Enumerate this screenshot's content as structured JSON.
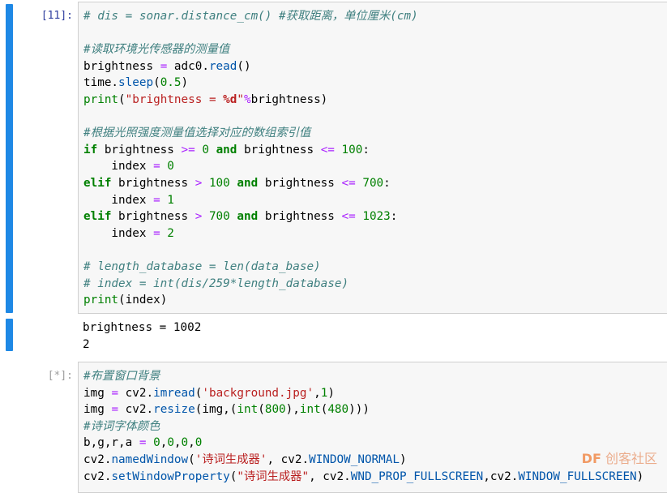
{
  "cells": [
    {
      "prompt": "[11]:",
      "lines": [
        [
          {
            "t": "# dis = sonar.distance_cm() #获取距离，单位厘米(cm)",
            "c": "cm"
          }
        ],
        [],
        [
          {
            "t": "#读取环境光传感器的测量值",
            "c": "cm"
          }
        ],
        [
          {
            "t": "brightness "
          },
          {
            "t": "=",
            "c": "op"
          },
          {
            "t": " adc0."
          },
          {
            "t": "read",
            "c": "fn"
          },
          {
            "t": "()"
          }
        ],
        [
          {
            "t": "time."
          },
          {
            "t": "sleep",
            "c": "fn"
          },
          {
            "t": "("
          },
          {
            "t": "0.5",
            "c": "num"
          },
          {
            "t": ")"
          }
        ],
        [
          {
            "t": "print",
            "c": "num"
          },
          {
            "t": "("
          },
          {
            "t": "\"brightness = ",
            "c": "str"
          },
          {
            "t": "%d",
            "c": "sp"
          },
          {
            "t": "\"",
            "c": "str"
          },
          {
            "t": "%",
            "c": "op"
          },
          {
            "t": "brightness)"
          }
        ],
        [],
        [
          {
            "t": "#根据光照强度测量值选择对应的数组索引值",
            "c": "cm"
          }
        ],
        [
          {
            "t": "if",
            "c": "kw"
          },
          {
            "t": " brightness "
          },
          {
            "t": ">=",
            "c": "op"
          },
          {
            "t": " "
          },
          {
            "t": "0",
            "c": "num"
          },
          {
            "t": " "
          },
          {
            "t": "and",
            "c": "kw"
          },
          {
            "t": " brightness "
          },
          {
            "t": "<=",
            "c": "op"
          },
          {
            "t": " "
          },
          {
            "t": "100",
            "c": "num"
          },
          {
            "t": ":"
          }
        ],
        [
          {
            "t": "    index "
          },
          {
            "t": "=",
            "c": "op"
          },
          {
            "t": " "
          },
          {
            "t": "0",
            "c": "num"
          }
        ],
        [
          {
            "t": "elif",
            "c": "kw"
          },
          {
            "t": " brightness "
          },
          {
            "t": ">",
            "c": "op"
          },
          {
            "t": " "
          },
          {
            "t": "100",
            "c": "num"
          },
          {
            "t": " "
          },
          {
            "t": "and",
            "c": "kw"
          },
          {
            "t": " brightness "
          },
          {
            "t": "<=",
            "c": "op"
          },
          {
            "t": " "
          },
          {
            "t": "700",
            "c": "num"
          },
          {
            "t": ":"
          }
        ],
        [
          {
            "t": "    index "
          },
          {
            "t": "=",
            "c": "op"
          },
          {
            "t": " "
          },
          {
            "t": "1",
            "c": "num"
          }
        ],
        [
          {
            "t": "elif",
            "c": "kw"
          },
          {
            "t": " brightness "
          },
          {
            "t": ">",
            "c": "op"
          },
          {
            "t": " "
          },
          {
            "t": "700",
            "c": "num"
          },
          {
            "t": " "
          },
          {
            "t": "and",
            "c": "kw"
          },
          {
            "t": " brightness "
          },
          {
            "t": "<=",
            "c": "op"
          },
          {
            "t": " "
          },
          {
            "t": "1023",
            "c": "num"
          },
          {
            "t": ":"
          }
        ],
        [
          {
            "t": "    index "
          },
          {
            "t": "=",
            "c": "op"
          },
          {
            "t": " "
          },
          {
            "t": "2",
            "c": "num"
          }
        ],
        [],
        [
          {
            "t": "# length_database = len(data_base)",
            "c": "cm"
          }
        ],
        [
          {
            "t": "# index = int(dis/259*length_database)",
            "c": "cm"
          }
        ],
        [
          {
            "t": "print",
            "c": "num"
          },
          {
            "t": "(index)"
          }
        ]
      ],
      "output": [
        "brightness = 1002",
        "2"
      ]
    },
    {
      "prompt": "[*]:",
      "lines": [
        [
          {
            "t": "#布置窗口背景",
            "c": "cm"
          }
        ],
        [
          {
            "t": "img "
          },
          {
            "t": "=",
            "c": "op"
          },
          {
            "t": " cv2."
          },
          {
            "t": "imread",
            "c": "fn"
          },
          {
            "t": "("
          },
          {
            "t": "'background.jpg'",
            "c": "str"
          },
          {
            "t": ","
          },
          {
            "t": "1",
            "c": "num"
          },
          {
            "t": ")"
          }
        ],
        [
          {
            "t": "img "
          },
          {
            "t": "=",
            "c": "op"
          },
          {
            "t": " cv2."
          },
          {
            "t": "resize",
            "c": "fn"
          },
          {
            "t": "(img,("
          },
          {
            "t": "int",
            "c": "num"
          },
          {
            "t": "("
          },
          {
            "t": "800",
            "c": "num"
          },
          {
            "t": "),"
          },
          {
            "t": "int",
            "c": "num"
          },
          {
            "t": "("
          },
          {
            "t": "480",
            "c": "num"
          },
          {
            "t": ")))"
          }
        ],
        [
          {
            "t": "#诗词字体颜色",
            "c": "cm"
          }
        ],
        [
          {
            "t": "b,g,r,a "
          },
          {
            "t": "=",
            "c": "op"
          },
          {
            "t": " "
          },
          {
            "t": "0",
            "c": "num"
          },
          {
            "t": ","
          },
          {
            "t": "0",
            "c": "num"
          },
          {
            "t": ","
          },
          {
            "t": "0",
            "c": "num"
          },
          {
            "t": ","
          },
          {
            "t": "0",
            "c": "num"
          }
        ],
        [
          {
            "t": "cv2."
          },
          {
            "t": "namedWindow",
            "c": "fn"
          },
          {
            "t": "("
          },
          {
            "t": "'诗词生成器'",
            "c": "str"
          },
          {
            "t": ", cv2."
          },
          {
            "t": "WINDOW_NORMAL",
            "c": "fn"
          },
          {
            "t": ")"
          }
        ],
        [
          {
            "t": "cv2."
          },
          {
            "t": "setWindowProperty",
            "c": "fn"
          },
          {
            "t": "("
          },
          {
            "t": "\"诗词生成器\"",
            "c": "str"
          },
          {
            "t": ", cv2."
          },
          {
            "t": "WND_PROP_FULLSCREEN",
            "c": "fn"
          },
          {
            "t": ",cv2."
          },
          {
            "t": "WINDOW_FULLSCREEN",
            "c": "fn"
          },
          {
            "t": ")"
          }
        ]
      ]
    }
  ],
  "watermark": {
    "brand": "DF",
    "text": "创客社区"
  },
  "colors": {
    "cell_bar": "#1e88e5",
    "prompt": "#303f9f",
    "keyword": "#008000",
    "string": "#ba2121",
    "comment": "#408080",
    "operator": "#aa22ff"
  }
}
